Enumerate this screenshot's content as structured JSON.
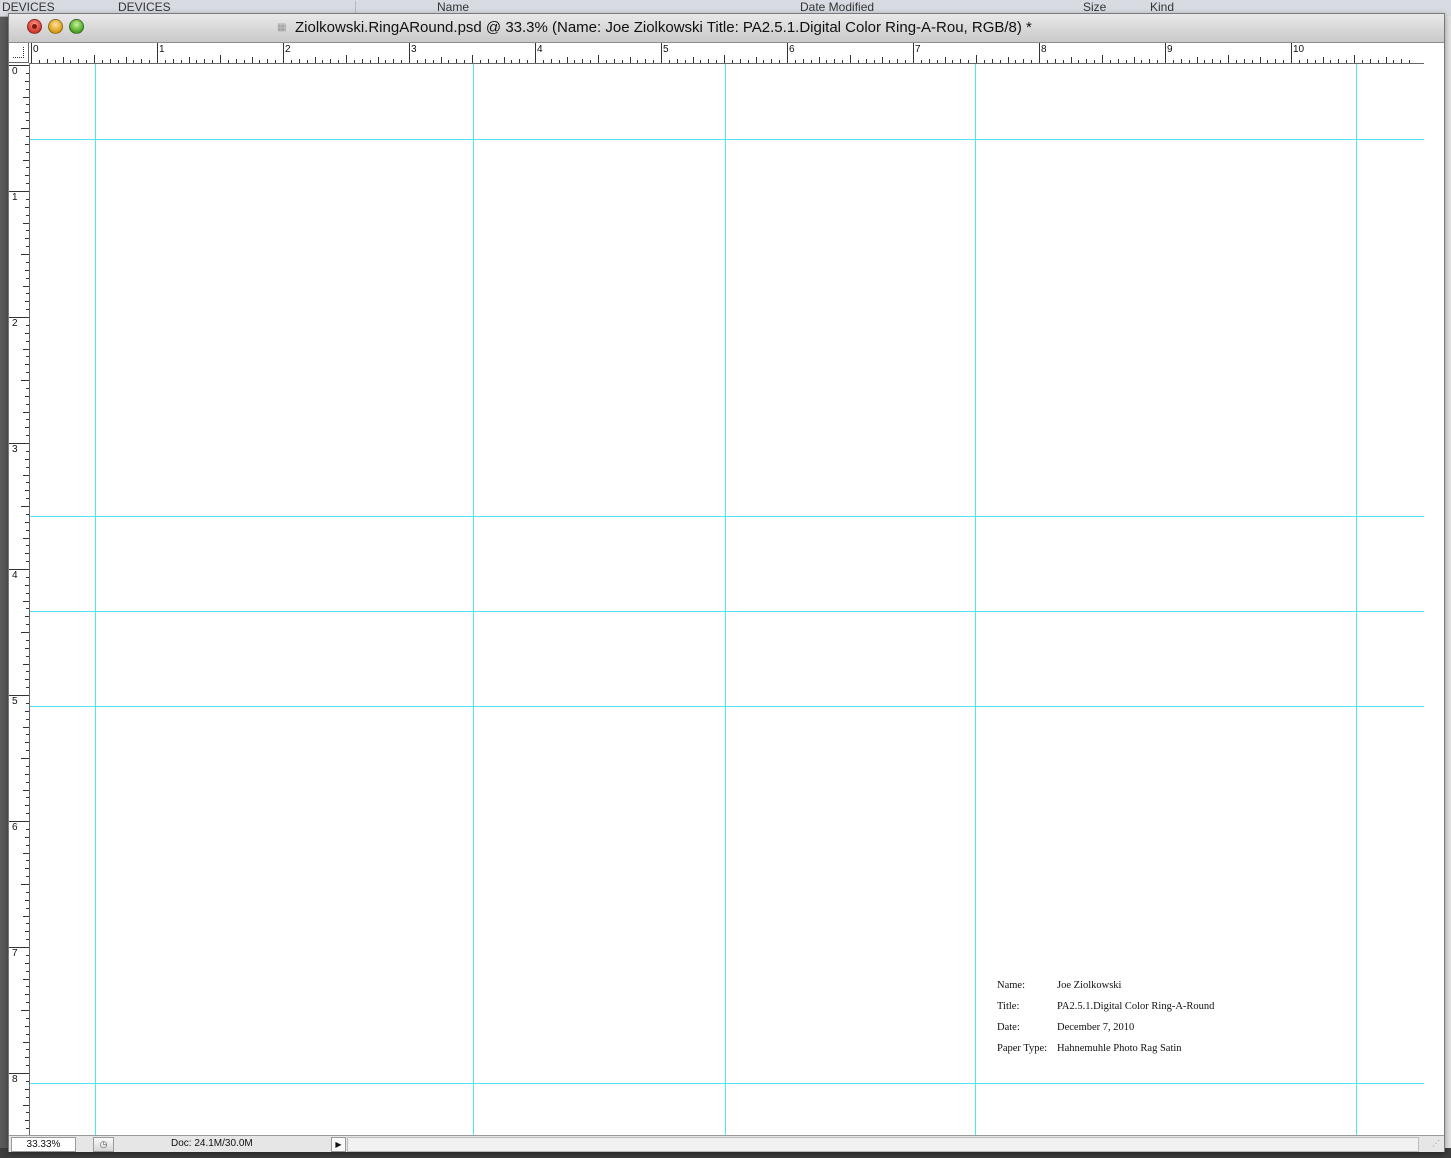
{
  "background": {
    "devices_left": "DEVICES",
    "devices_right": "DEVICES",
    "col_name": "Name",
    "col_date": "Date Modified",
    "col_size": "Size",
    "col_kind": "Kind"
  },
  "window": {
    "title": "Ziolkowski.RingARound.psd @ 33.3% (Name:  Joe Ziolkowski Title:   PA2.5.1.Digital Color Ring-A-Rou, RGB/8) *"
  },
  "ruler": {
    "h_labels": [
      "0",
      "1",
      "2",
      "3",
      "4",
      "5",
      "6",
      "7",
      "8",
      "9",
      "10"
    ],
    "v_labels": [
      "0",
      "1",
      "2",
      "3",
      "4",
      "5",
      "6",
      "7",
      "8"
    ]
  },
  "canvas_info": {
    "name_label": "Name:",
    "name_value": "Joe Ziolkowski",
    "title_label": "Title:",
    "title_value": "PA2.5.1.Digital Color Ring-A-Round",
    "date_label": "Date:",
    "date_value": "December 7, 2010",
    "paper_label": "Paper Type:",
    "paper_value": "Hahnemuhle Photo Rag Satin"
  },
  "status": {
    "zoom": "33.33%",
    "doc": "Doc: 24.1M/30.0M",
    "arrow": "▶"
  },
  "colors": {
    "guide": "#4fe6ee"
  }
}
